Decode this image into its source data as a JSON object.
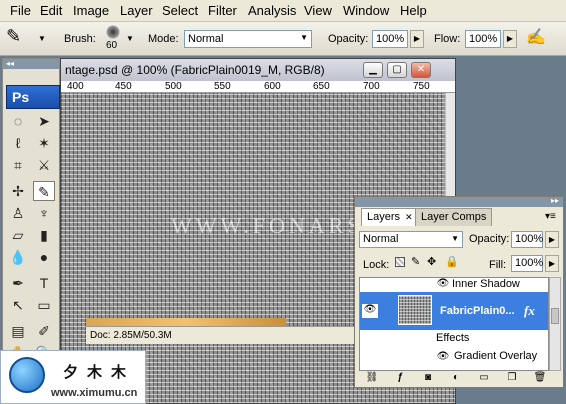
{
  "menubar": {
    "items": [
      "File",
      "Edit",
      "Image",
      "Layer",
      "Select",
      "Filter",
      "Analysis",
      "View",
      "Window",
      "Help"
    ]
  },
  "options_bar": {
    "brush_label": "Brush:",
    "brush_size": "60",
    "mode_label": "Mode:",
    "mode_value": "Normal",
    "opacity_label": "Opacity:",
    "opacity_value": "100%",
    "flow_label": "Flow:",
    "flow_value": "100%"
  },
  "toolbox": {
    "logo": "Ps"
  },
  "document": {
    "title": "ntage.psd @ 100% (FabricPlain0019_M, RGB/8)",
    "ruler_labels": [
      "400",
      "450",
      "500",
      "550",
      "600",
      "650",
      "700",
      "750"
    ],
    "watermark": "WWW.FONARS.COM",
    "status": "Doc: 2.85M/50.3M"
  },
  "layers_panel": {
    "tabs": [
      "Layers",
      "Layer Comps"
    ],
    "blend_mode": "Normal",
    "opacity_label": "Opacity:",
    "opacity_value": "100%",
    "lock_label": "Lock:",
    "fill_label": "Fill:",
    "fill_value": "100%",
    "rows": {
      "inner_shadow": "Inner Shadow",
      "layer_name": "FabricPlain0...",
      "fx": "fx",
      "effects": "Effects",
      "gradient_overlay": "Gradient Overlay"
    }
  },
  "watermark_logo": {
    "chinese": "夕木木",
    "url": "www.ximumu.cn"
  },
  "colors": {
    "selection": "#3d7fe0",
    "menubar": "#ece9d8",
    "ps_blue": "#1a4fa8"
  }
}
